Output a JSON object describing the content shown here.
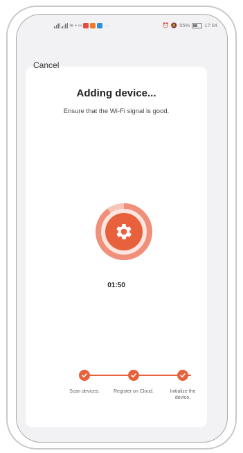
{
  "status_bar": {
    "left_signal": "⁴ᴳ",
    "right_text": "55%",
    "time": "17:04"
  },
  "header": {
    "cancel_label": "Cancel"
  },
  "main": {
    "title": "Adding device...",
    "subtitle": "Ensure that the Wi-Fi signal is good.",
    "timer": "01:50",
    "progress_fraction": 0.9
  },
  "steps": [
    {
      "label": "Scan devices.",
      "done": true
    },
    {
      "label": "Register on Cloud.",
      "done": true
    },
    {
      "label": "Initialize the device.",
      "done": true
    }
  ],
  "colors": {
    "accent": "#e8613d",
    "accent_light": "#f7c4b8"
  },
  "icons": {
    "center": "gear-icon",
    "step": "check-icon"
  }
}
